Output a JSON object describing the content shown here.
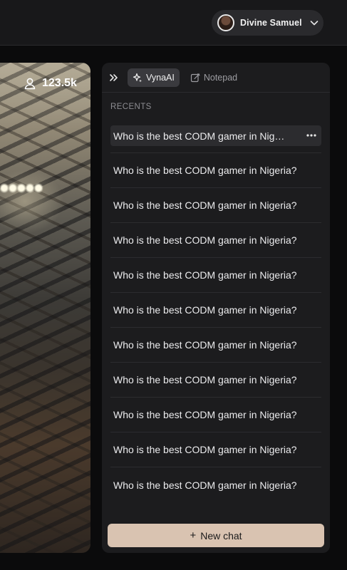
{
  "header": {
    "user_name": "Divine Samuel"
  },
  "stream": {
    "followers": "123.5k"
  },
  "panel": {
    "tabs": [
      {
        "label": "VynaAI",
        "active": true,
        "icon": "sparkle-icon"
      },
      {
        "label": "Notepad",
        "active": false,
        "icon": "notepad-icon"
      }
    ],
    "recents_title": "RECENTS",
    "recents": [
      "Who is the best CODM gamer in Nigeria?",
      "Who is the best CODM gamer in Nigeria?",
      "Who is the best CODM gamer in Nigeria?",
      "Who is the best CODM gamer in Nigeria?",
      "Who is the best CODM gamer in Nigeria?",
      "Who is the best CODM gamer in Nigeria?",
      "Who is the best CODM gamer in Nigeria?",
      "Who is the best CODM gamer in Nigeria?",
      "Who is the best CODM gamer in Nigeria?",
      "Who is the best CODM gamer in Nigeria?",
      "Who is the best CODM gamer in Nigeria?"
    ],
    "new_chat_label": "New chat"
  },
  "colors": {
    "accent": "#d9c3b1",
    "panel_bg": "#1c1c1e",
    "page_bg": "#0b0b0c"
  }
}
